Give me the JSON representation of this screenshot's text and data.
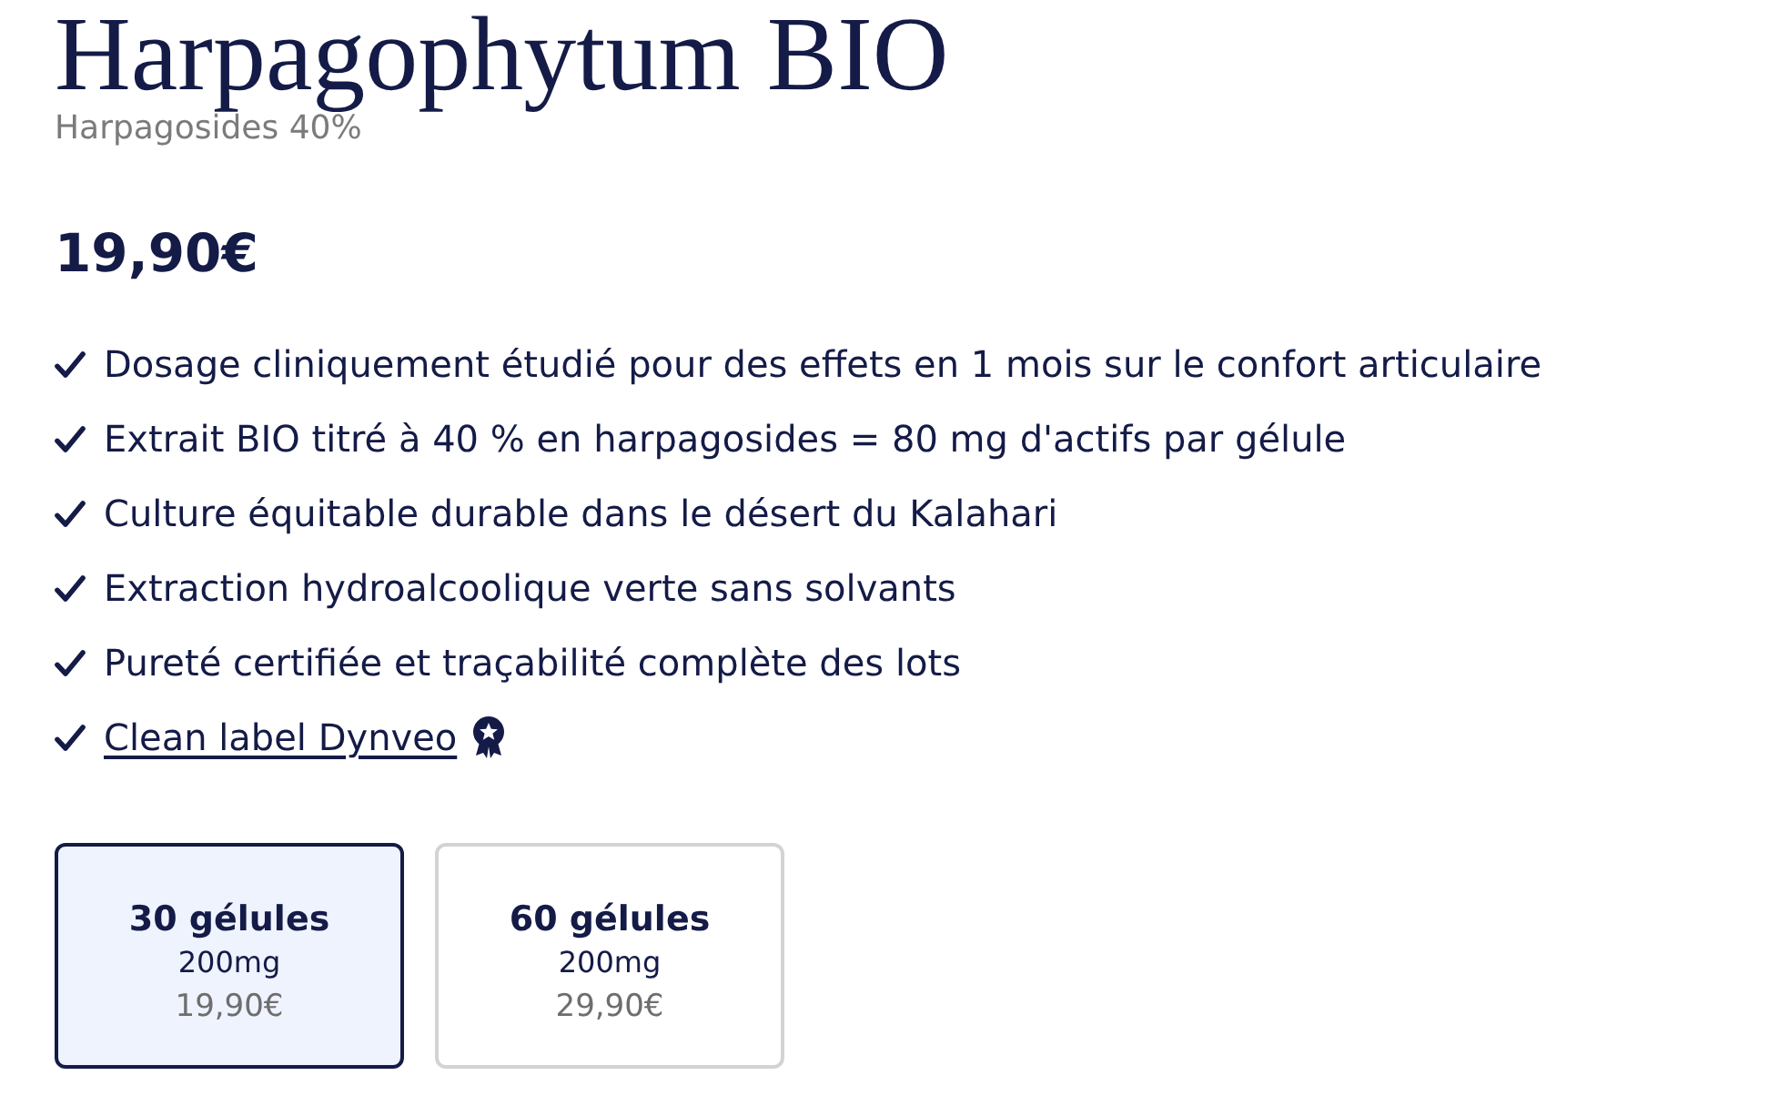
{
  "product": {
    "title": "Harpagophytum BIO",
    "subtitle": "Harpagosides 40%",
    "price": "19,90€"
  },
  "benefits": [
    {
      "kind": "text",
      "text": "Dosage cliniquement étudié pour des effets en 1 mois sur le confort articulaire"
    },
    {
      "kind": "text",
      "text": "Extrait BIO titré à 40 % en harpagosides = 80 mg d'actifs par gélule"
    },
    {
      "kind": "text",
      "text": "Culture équitable durable dans le désert du Kalahari"
    },
    {
      "kind": "text",
      "text": "Extraction hydroalcoolique verte sans solvants"
    },
    {
      "kind": "text",
      "text": "Pureté certifiée et traçabilité complète des lots"
    },
    {
      "kind": "link",
      "text": "Clean label Dynveo"
    }
  ],
  "variants": [
    {
      "name": "30 gélules",
      "dosage": "200mg",
      "price": "19,90€",
      "selected": true
    },
    {
      "name": "60 gélules",
      "dosage": "200mg",
      "price": "29,90€",
      "selected": false
    }
  ]
}
